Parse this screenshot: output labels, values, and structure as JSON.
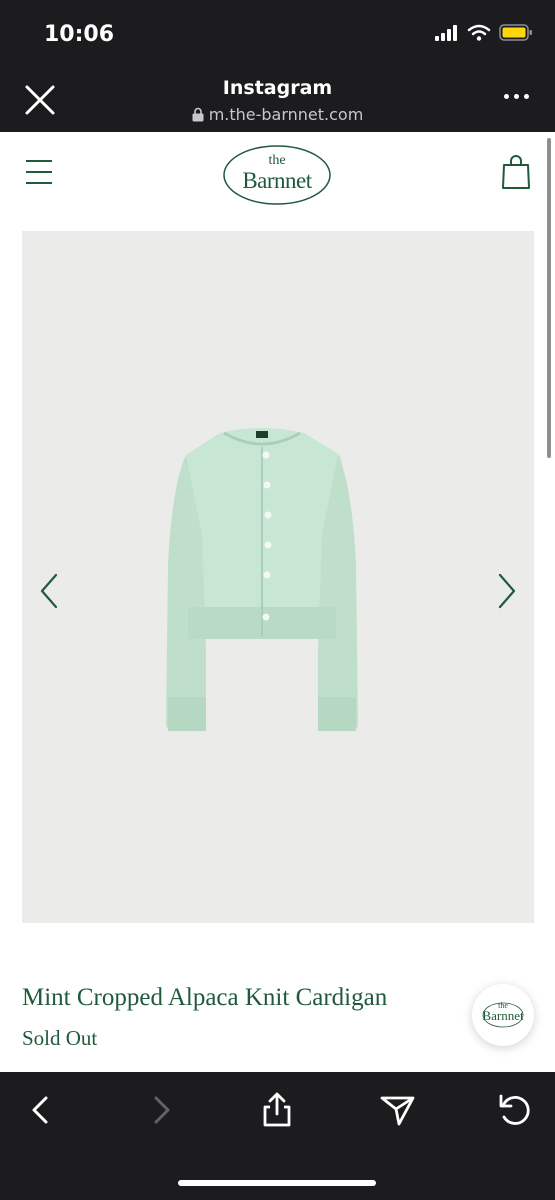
{
  "status_bar": {
    "time": "10:06"
  },
  "browser": {
    "title": "Instagram",
    "url": "m.the-barnnet.com"
  },
  "site": {
    "logo_the": "the",
    "logo_name": "Barnnet"
  },
  "product": {
    "title": "Mint Cropped Alpaca Knit Cardigan",
    "status": "Sold Out"
  },
  "chat": {
    "logo_the": "the",
    "logo_name": "Barnnet"
  },
  "colors": {
    "brand_green": "#1f5a3a",
    "chrome": "#1c1c1e",
    "gallery_bg": "#ebebe9",
    "mint": "#c8e6d4"
  },
  "icons": {
    "close": "close-icon",
    "more": "more-icon",
    "lock": "lock-icon",
    "menu": "hamburger-menu-icon",
    "cart": "shopping-bag-icon",
    "prev": "chevron-left-icon",
    "next": "chevron-right-icon",
    "back": "back-arrow-icon",
    "forward": "forward-arrow-icon",
    "share": "share-icon",
    "send": "send-icon",
    "reload": "reload-icon"
  }
}
